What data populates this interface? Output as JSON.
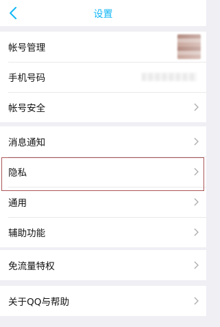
{
  "header": {
    "title": "设置"
  },
  "groups": [
    {
      "items": [
        {
          "label": "帐号管理"
        },
        {
          "label": "手机号码"
        },
        {
          "label": "帐号安全"
        }
      ]
    },
    {
      "items": [
        {
          "label": "消息通知"
        },
        {
          "label": "隐私"
        },
        {
          "label": "通用"
        },
        {
          "label": "辅助功能"
        }
      ]
    },
    {
      "items": [
        {
          "label": "免流量特权"
        }
      ]
    },
    {
      "items": [
        {
          "label": "关于QQ与帮助"
        }
      ]
    }
  ],
  "colors": {
    "accent": "#12b7f5",
    "background": "#efeff4",
    "highlight_border": "#a95555"
  },
  "icons": {
    "back": "chevron-left-icon",
    "row_arrow": "chevron-right-icon"
  }
}
